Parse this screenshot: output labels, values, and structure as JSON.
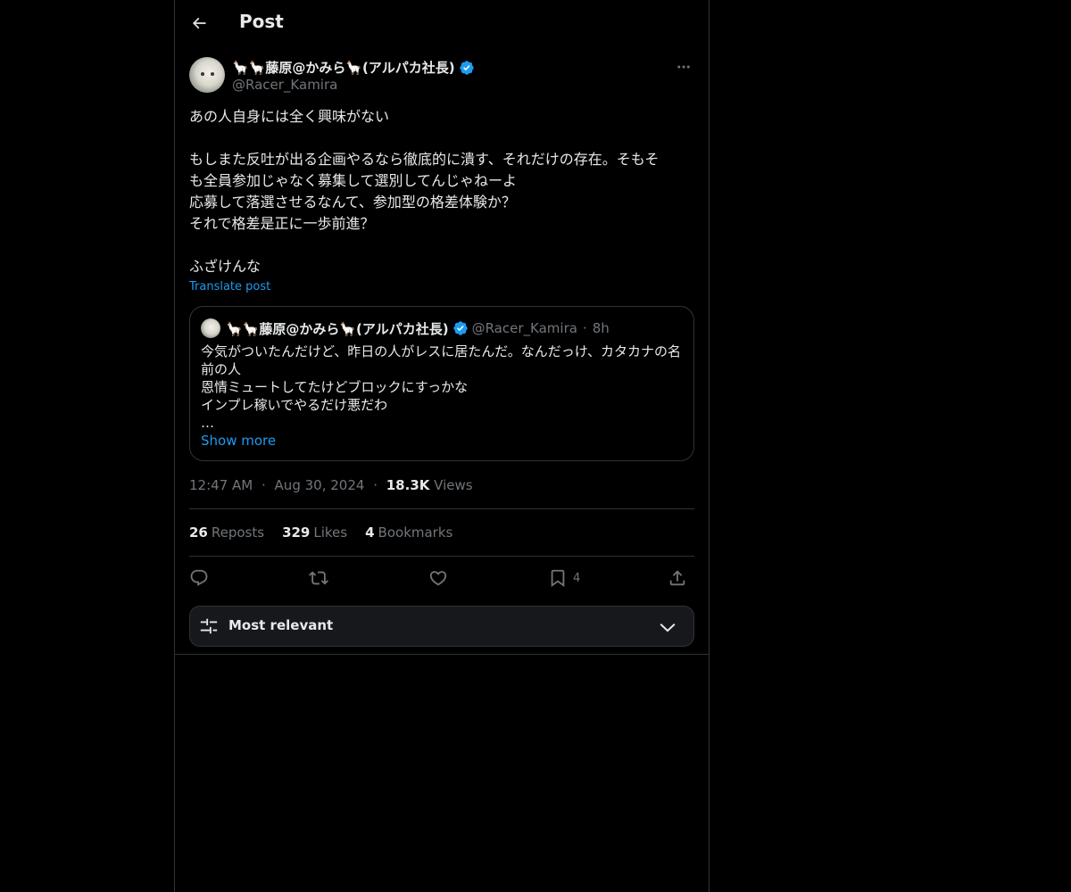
{
  "header": {
    "title": "Post",
    "back_icon": "arrow-left-icon"
  },
  "post": {
    "author": {
      "display_name": "🦙🦙藤原@かみら🦙(アルパカ社長)",
      "handle": "@Racer_Kamira",
      "verified": true
    },
    "text_lines": {
      "line1": "あの人自身には全く興味がない",
      "line2": "もしまた反吐が出る企画やるなら徹底的に潰す、それだけの存在。そもそ",
      "line3": "も全員参加じゃなく募集して選別してんじゃねーよ",
      "line4": "応募して落選させるなんて、参加型の格差体験か？",
      "line5": "それで格差是正に一歩前進？",
      "line6": "ふざけんな"
    },
    "translate_label": "Translate post",
    "quote": {
      "display_name": "🦙🦙藤原@かみら🦙(アルパカ社長)",
      "handle": "@Racer_Kamira",
      "separator": "·",
      "time": "8h",
      "lines": {
        "line1": "今気がついたんだけど、昨日の人がレスに居たんだ。なんだっけ、カタカナの名",
        "line2": "前の人",
        "line3": "恩情ミュートしてたけどブロックにすっかな",
        "line4": "インプレ稼いでやるだけ悪だわ",
        "line5": "…"
      },
      "show_more": "Show more"
    },
    "meta": {
      "time": "12:47 AM",
      "separator": "·",
      "date": "Aug 30, 2024",
      "views_count": "18.3K",
      "views_label": "Views"
    },
    "stats": {
      "reposts_count": "26",
      "reposts_label": "Reposts",
      "likes_count": "329",
      "likes_label": "Likes",
      "bookmarks_count": "4",
      "bookmarks_label": "Bookmarks"
    },
    "actions": {
      "reply_icon": "reply-icon",
      "repost_icon": "repost-icon",
      "like_icon": "heart-icon",
      "bookmark_icon": "bookmark-icon",
      "bookmark_count": "4",
      "share_icon": "share-icon"
    }
  },
  "sort": {
    "label": "Most relevant",
    "icon": "sliders-icon",
    "chevron": "chevron-down-icon"
  },
  "colors": {
    "background": "#000000",
    "text": "#e7e9ea",
    "secondary": "#71767b",
    "accent": "#1d9bf0",
    "border": "#2f3336"
  }
}
